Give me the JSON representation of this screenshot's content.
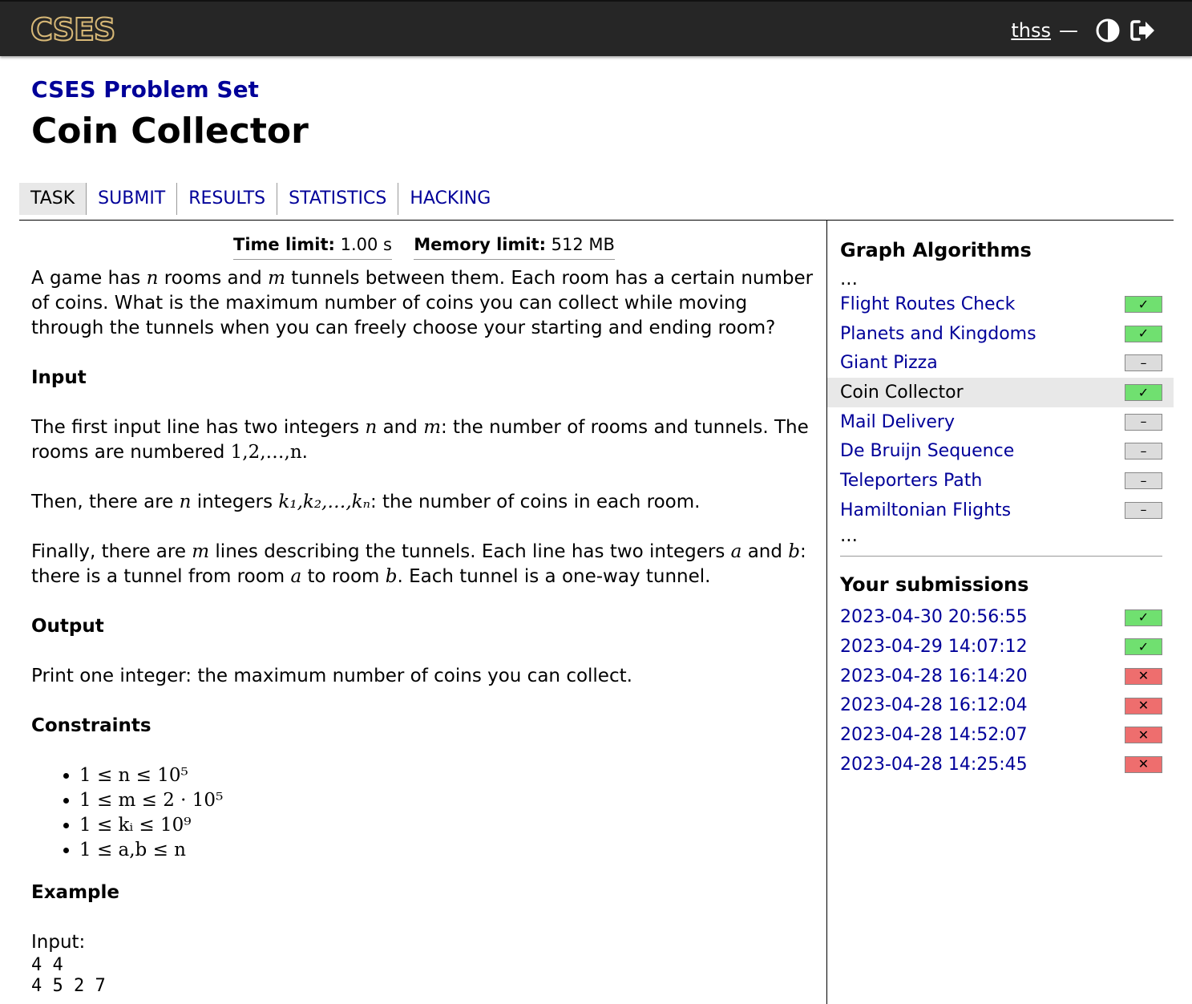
{
  "header": {
    "logo": "CSES",
    "username": "thss",
    "dash": "—",
    "theme_icon": "half-circle-icon",
    "logout_icon": "logout-icon"
  },
  "page": {
    "set_title": "CSES Problem Set",
    "problem_title": "Coin Collector"
  },
  "tabs": [
    "TASK",
    "SUBMIT",
    "RESULTS",
    "STATISTICS",
    "HACKING"
  ],
  "active_tab": "TASK",
  "limits": {
    "time_label": "Time limit:",
    "time_value": "1.00 s",
    "memory_label": "Memory limit:",
    "memory_value": "512 MB"
  },
  "statement": {
    "intro_a": "A game has ",
    "intro_n": "n",
    "intro_b": " rooms and ",
    "intro_m": "m",
    "intro_c": " tunnels between them. Each room has a certain number of coins. What is the maximum number of coins you can collect while moving through the tunnels when you can freely choose your starting and ending room?",
    "input_heading": "Input",
    "in1_a": "The first input line has two integers ",
    "in1_n": "n",
    "in1_b": " and ",
    "in1_m": "m",
    "in1_c": ": the number of rooms and tunnels. The rooms are numbered ",
    "in1_seq": "1,2,…,n",
    "in1_d": ".",
    "in2_a": "Then, there are ",
    "in2_n": "n",
    "in2_b": " integers ",
    "in2_seq": "k₁,k₂,…,kₙ",
    "in2_c": ": the number of coins in each room.",
    "in3_a": "Finally, there are ",
    "in3_m": "m",
    "in3_b": " lines describing the tunnels. Each line has two integers ",
    "in3_x": "a",
    "in3_c": " and ",
    "in3_y": "b",
    "in3_d": ": there is a tunnel from room ",
    "in3_x2": "a",
    "in3_e": " to room ",
    "in3_y2": "b",
    "in3_f": ". Each tunnel is a one-way tunnel.",
    "output_heading": "Output",
    "output_text": "Print one integer: the maximum number of coins you can collect.",
    "constraints_heading": "Constraints",
    "constraints": [
      "1 ≤ n ≤ 10⁵",
      "1 ≤ m ≤ 2 · 10⁵",
      "1 ≤ kᵢ ≤ 10⁹",
      "1 ≤ a,b ≤ n"
    ],
    "example_heading": "Example",
    "example_input_label": "Input:",
    "example_input_lines": [
      "4 4",
      "4 5 2 7"
    ]
  },
  "sidebar": {
    "section_title": "Graph Algorithms",
    "ellipsis": "...",
    "problems": [
      {
        "name": "Flight Routes Check",
        "status": "ok",
        "mark": "✓"
      },
      {
        "name": "Planets and Kingdoms",
        "status": "ok",
        "mark": "✓"
      },
      {
        "name": "Giant Pizza",
        "status": "none",
        "mark": "–"
      },
      {
        "name": "Coin Collector",
        "status": "ok",
        "mark": "✓"
      },
      {
        "name": "Mail Delivery",
        "status": "none",
        "mark": "–"
      },
      {
        "name": "De Bruijn Sequence",
        "status": "none",
        "mark": "–"
      },
      {
        "name": "Teleporters Path",
        "status": "none",
        "mark": "–"
      },
      {
        "name": "Hamiltonian Flights",
        "status": "none",
        "mark": "–"
      }
    ],
    "submissions_title": "Your submissions",
    "submissions": [
      {
        "time": "2023-04-30 20:56:55",
        "status": "ok",
        "mark": "✓"
      },
      {
        "time": "2023-04-29 14:07:12",
        "status": "ok",
        "mark": "✓"
      },
      {
        "time": "2023-04-28 16:14:20",
        "status": "fail",
        "mark": "✕"
      },
      {
        "time": "2023-04-28 16:12:04",
        "status": "fail",
        "mark": "✕"
      },
      {
        "time": "2023-04-28 14:52:07",
        "status": "fail",
        "mark": "✕"
      },
      {
        "time": "2023-04-28 14:25:45",
        "status": "fail",
        "mark": "✕"
      }
    ]
  },
  "colors": {
    "link": "#000099",
    "ok": "#70e070",
    "fail": "#ee6e6e",
    "none": "#dcdcdc",
    "topbar": "#262626",
    "logo": "#d7b877"
  }
}
